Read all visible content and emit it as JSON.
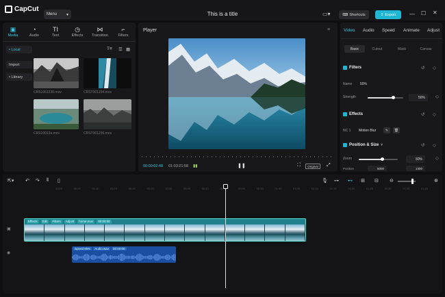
{
  "app": {
    "name": "CapCut",
    "title": "This is a title"
  },
  "topbar": {
    "menu_label": "Menu",
    "shortcuts_label": "Shortcuts",
    "export_label": "Export"
  },
  "media": {
    "tabs": [
      {
        "label": "Media",
        "icon": "media-icon"
      },
      {
        "label": "Audio",
        "icon": "audio-icon"
      },
      {
        "label": "Text",
        "icon": "text-icon"
      },
      {
        "label": "Effects",
        "icon": "effects-icon"
      },
      {
        "label": "Transition",
        "icon": "transition-icon"
      },
      {
        "label": "Filters",
        "icon": "filters-icon"
      }
    ],
    "sidebar": {
      "local": "• Local",
      "import": "Import",
      "library": "• Library"
    },
    "thumbnails": [
      {
        "label": "CRS1061230.mov"
      },
      {
        "label": "CRST001234.mov"
      },
      {
        "label": "CRS10013a.mov"
      },
      {
        "label": "CRST001236.mov"
      }
    ]
  },
  "player": {
    "title": "Player",
    "current_time": "00:00:02:48",
    "total_time": "01:03:21:58",
    "ratio_label": "Original"
  },
  "props": {
    "tabs": [
      "Video",
      "Audio",
      "Speed",
      "Animate",
      "Adjust"
    ],
    "subtabs": [
      "Basic",
      "Cutout",
      "Mask",
      "Canvas"
    ],
    "filters_title": "Filters",
    "filter_name_label": "Name",
    "filter_name_value": "50%",
    "strength_label": "Strength",
    "strength_value": "50%",
    "strength_level": 0.73,
    "effects_title": "Effects",
    "effect_track": "NC 1",
    "effect_name": "Motion Blur",
    "position_title": "Position & Size",
    "zoom_label": "Zoom",
    "zoom_value": "50%",
    "zoom_level": 0.6,
    "position_label": "Position",
    "position_x": "5000",
    "position_y": "1400"
  },
  "timeline": {
    "ruler": [
      "00:00",
      "00:05",
      "00:10",
      "00:15",
      "00:20",
      "00:25",
      "00:30",
      "00:35",
      "00:40",
      "00:45",
      "00:50",
      "00:55",
      "01:00",
      "01:05",
      "01:10",
      "01:15",
      "01:20",
      "01:25",
      "01:30",
      "01:35",
      "01:40"
    ],
    "video_clip_tags": [
      "Effects",
      "Edit",
      "Filters",
      "Adjust",
      "home.mov",
      "00:00:00"
    ],
    "audio_clip_tags": [
      "Speed 85%",
      "Audio.wav",
      "00:00:00"
    ]
  },
  "colors": {
    "accent": "#1fb6d4",
    "clip_border": "#4fe0d0",
    "audio": "#1b4ea0"
  }
}
